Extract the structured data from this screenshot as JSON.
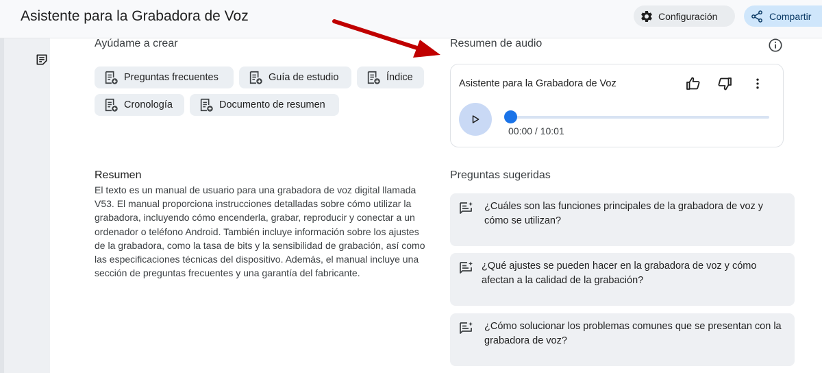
{
  "header": {
    "title": "Asistente para la Grabadora de Voz",
    "config_label": "Configuración",
    "share_label": "Compartir"
  },
  "create": {
    "label": "Ayúdame a crear",
    "chips": [
      "Preguntas frecuentes",
      "Guía de estudio",
      "Índice",
      "Cronología",
      "Documento de resumen"
    ]
  },
  "summary": {
    "title": "Resumen",
    "text": "El texto es un manual de usuario para una grabadora de voz digital llamada V53. El manual proporciona instrucciones detalladas sobre cómo utilizar la grabadora, incluyendo cómo encenderla, grabar, reproducir y conectar a un ordenador o teléfono Android. También incluye información sobre los ajustes de la grabadora, como la tasa de bits y la sensibilidad de grabación, así como las especificaciones técnicas del dispositivo. Además, el manual incluye una sección de preguntas frecuentes y una garantía del fabricante."
  },
  "audio": {
    "label": "Resumen de audio",
    "card_title": "Asistente para la Grabadora de Voz",
    "time": "00:00 / 10:01",
    "progress": 0
  },
  "suggested": {
    "label": "Preguntas sugeridas",
    "questions": [
      "¿Cuáles son las funciones principales de la grabadora de voz y cómo se utilizan?",
      "¿Qué ajustes se pueden hacer en la grabadora de voz y cómo afectan a la calidad de la grabación?",
      "¿Cómo solucionar los problemas comunes que se presentan con la grabadora de voz?"
    ]
  },
  "colors": {
    "accent": "#1a73e8",
    "share_bg": "#cfe6fb",
    "chip_bg": "#ebeff3",
    "annotation_arrow": "#c00000"
  },
  "icons": {
    "config": "gear-icon",
    "share": "share-icon",
    "sidebar_note": "note-icon",
    "chip": "add-document-icon",
    "info": "info-icon",
    "like": "thumb-up-icon",
    "dislike": "thumb-down-icon",
    "menu": "more-vert-icon",
    "play": "play-icon",
    "question": "sparkle-question-icon"
  }
}
